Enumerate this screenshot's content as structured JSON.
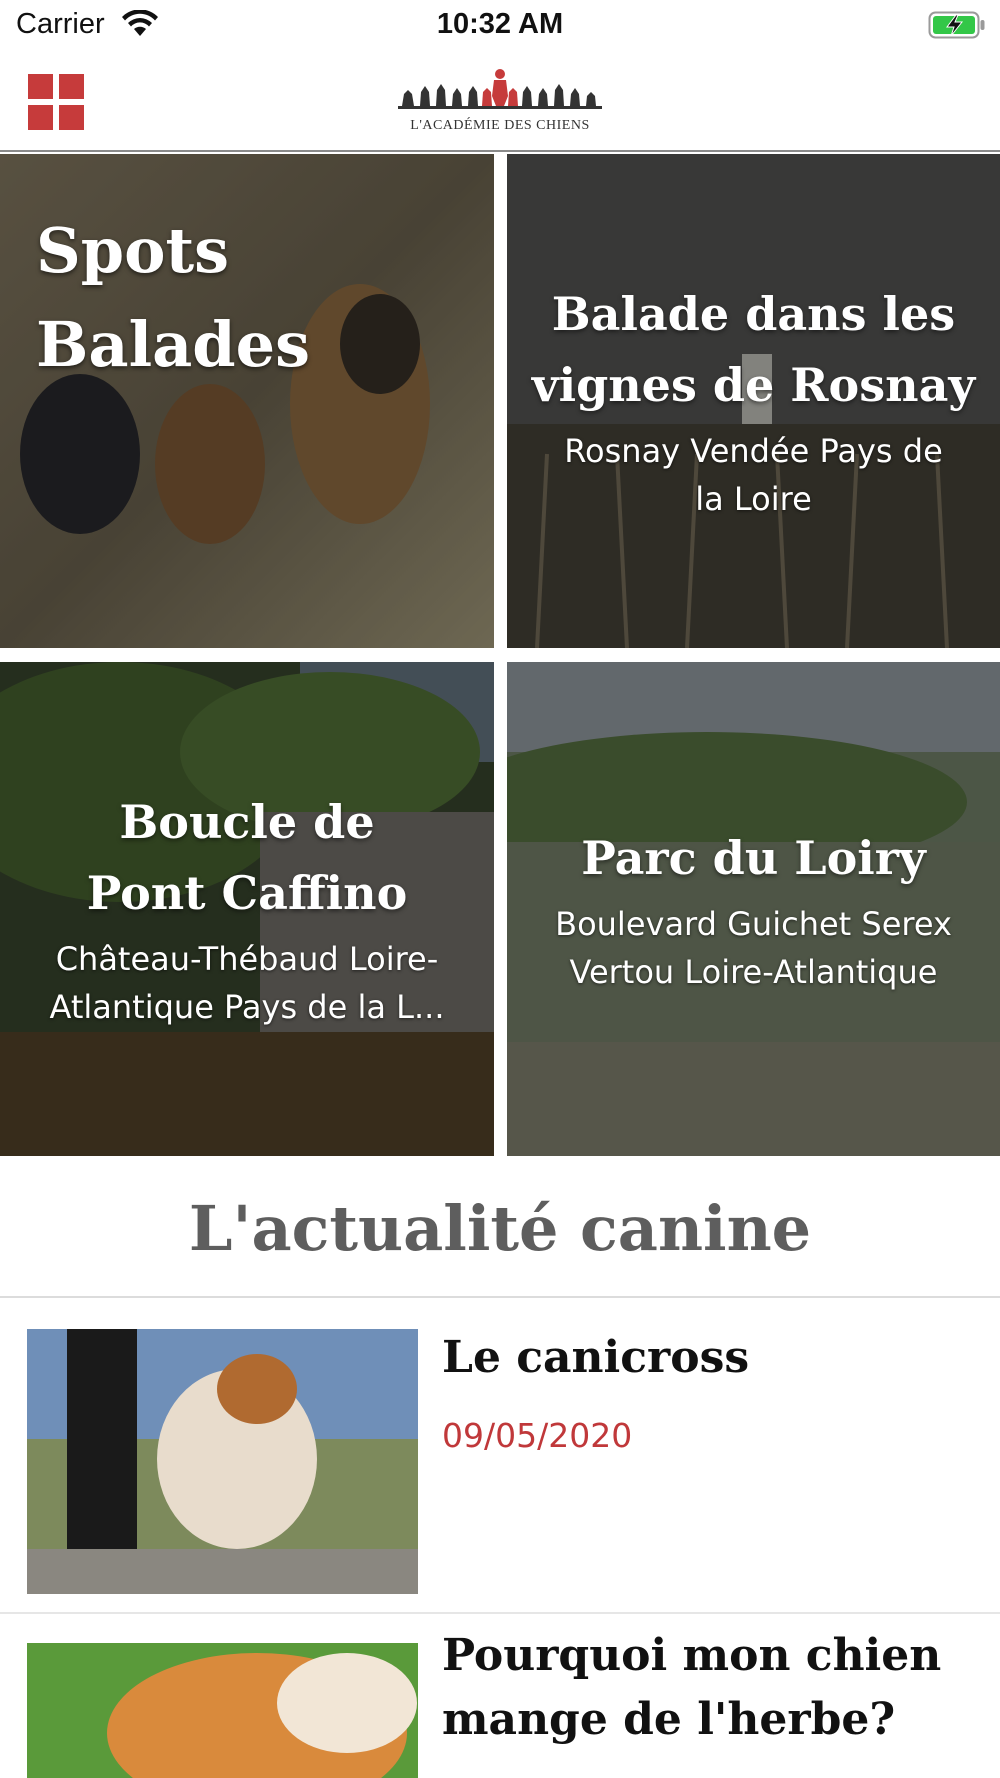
{
  "status_bar": {
    "carrier": "Carrier",
    "time": "10:32 AM",
    "icons": [
      "wifi-icon",
      "battery-charging-icon"
    ]
  },
  "header": {
    "menu_icon": "grid-menu-icon",
    "logo_text": "L'ACADÉMIE DES CHIENS",
    "accent_color": "#c63b3b"
  },
  "tiles": [
    {
      "title_line1": "Spots",
      "title_line2": "Balades"
    },
    {
      "title_line1": "Balade dans les",
      "title_line2": "vignes de Rosnay",
      "subtitle_line1": "Rosnay Vendée Pays de",
      "subtitle_line2": "la Loire"
    },
    {
      "title_line1": "Boucle de",
      "title_line2": "Pont Caffino",
      "subtitle_line1": "Château-Thébaud Loire-",
      "subtitle_line2": "Atlantique Pays de la L..."
    },
    {
      "title_line1": "Parc du Loiry",
      "subtitle_line1": "Boulevard Guichet Serex",
      "subtitle_line2": "Vertou Loire-Atlantique"
    }
  ],
  "news": {
    "heading": "L'actualité canine",
    "items": [
      {
        "title": "Le canicross",
        "date": "09/05/2020"
      },
      {
        "title_line1": "Pourquoi mon chien",
        "title_line2": "mange de l'herbe?"
      }
    ],
    "date_color": "#c0383a"
  }
}
